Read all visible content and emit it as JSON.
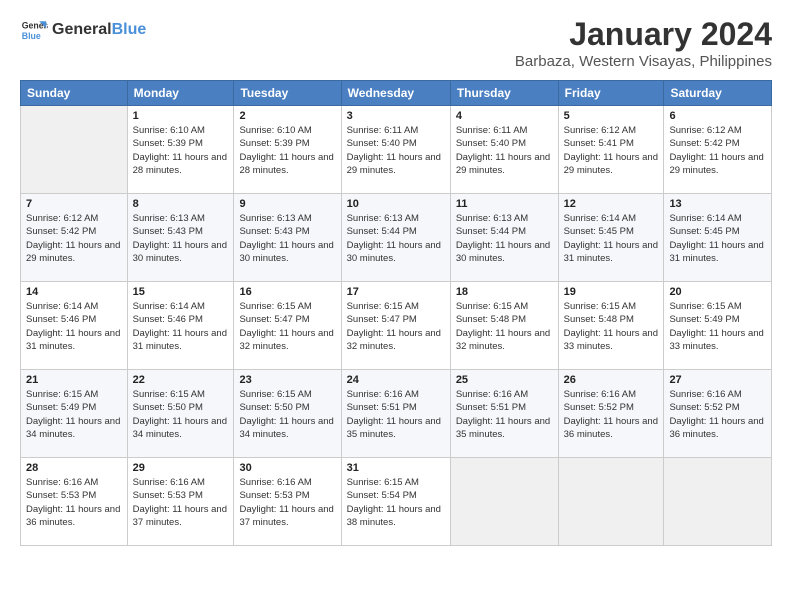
{
  "header": {
    "logo_general": "General",
    "logo_blue": "Blue",
    "title": "January 2024",
    "location": "Barbaza, Western Visayas, Philippines"
  },
  "days_of_week": [
    "Sunday",
    "Monday",
    "Tuesday",
    "Wednesday",
    "Thursday",
    "Friday",
    "Saturday"
  ],
  "weeks": [
    [
      {
        "day": "",
        "sunrise": "",
        "sunset": "",
        "daylight": ""
      },
      {
        "day": "1",
        "sunrise": "Sunrise: 6:10 AM",
        "sunset": "Sunset: 5:39 PM",
        "daylight": "Daylight: 11 hours and 28 minutes."
      },
      {
        "day": "2",
        "sunrise": "Sunrise: 6:10 AM",
        "sunset": "Sunset: 5:39 PM",
        "daylight": "Daylight: 11 hours and 28 minutes."
      },
      {
        "day": "3",
        "sunrise": "Sunrise: 6:11 AM",
        "sunset": "Sunset: 5:40 PM",
        "daylight": "Daylight: 11 hours and 29 minutes."
      },
      {
        "day": "4",
        "sunrise": "Sunrise: 6:11 AM",
        "sunset": "Sunset: 5:40 PM",
        "daylight": "Daylight: 11 hours and 29 minutes."
      },
      {
        "day": "5",
        "sunrise": "Sunrise: 6:12 AM",
        "sunset": "Sunset: 5:41 PM",
        "daylight": "Daylight: 11 hours and 29 minutes."
      },
      {
        "day": "6",
        "sunrise": "Sunrise: 6:12 AM",
        "sunset": "Sunset: 5:42 PM",
        "daylight": "Daylight: 11 hours and 29 minutes."
      }
    ],
    [
      {
        "day": "7",
        "sunrise": "Sunrise: 6:12 AM",
        "sunset": "Sunset: 5:42 PM",
        "daylight": "Daylight: 11 hours and 29 minutes."
      },
      {
        "day": "8",
        "sunrise": "Sunrise: 6:13 AM",
        "sunset": "Sunset: 5:43 PM",
        "daylight": "Daylight: 11 hours and 30 minutes."
      },
      {
        "day": "9",
        "sunrise": "Sunrise: 6:13 AM",
        "sunset": "Sunset: 5:43 PM",
        "daylight": "Daylight: 11 hours and 30 minutes."
      },
      {
        "day": "10",
        "sunrise": "Sunrise: 6:13 AM",
        "sunset": "Sunset: 5:44 PM",
        "daylight": "Daylight: 11 hours and 30 minutes."
      },
      {
        "day": "11",
        "sunrise": "Sunrise: 6:13 AM",
        "sunset": "Sunset: 5:44 PM",
        "daylight": "Daylight: 11 hours and 30 minutes."
      },
      {
        "day": "12",
        "sunrise": "Sunrise: 6:14 AM",
        "sunset": "Sunset: 5:45 PM",
        "daylight": "Daylight: 11 hours and 31 minutes."
      },
      {
        "day": "13",
        "sunrise": "Sunrise: 6:14 AM",
        "sunset": "Sunset: 5:45 PM",
        "daylight": "Daylight: 11 hours and 31 minutes."
      }
    ],
    [
      {
        "day": "14",
        "sunrise": "Sunrise: 6:14 AM",
        "sunset": "Sunset: 5:46 PM",
        "daylight": "Daylight: 11 hours and 31 minutes."
      },
      {
        "day": "15",
        "sunrise": "Sunrise: 6:14 AM",
        "sunset": "Sunset: 5:46 PM",
        "daylight": "Daylight: 11 hours and 31 minutes."
      },
      {
        "day": "16",
        "sunrise": "Sunrise: 6:15 AM",
        "sunset": "Sunset: 5:47 PM",
        "daylight": "Daylight: 11 hours and 32 minutes."
      },
      {
        "day": "17",
        "sunrise": "Sunrise: 6:15 AM",
        "sunset": "Sunset: 5:47 PM",
        "daylight": "Daylight: 11 hours and 32 minutes."
      },
      {
        "day": "18",
        "sunrise": "Sunrise: 6:15 AM",
        "sunset": "Sunset: 5:48 PM",
        "daylight": "Daylight: 11 hours and 32 minutes."
      },
      {
        "day": "19",
        "sunrise": "Sunrise: 6:15 AM",
        "sunset": "Sunset: 5:48 PM",
        "daylight": "Daylight: 11 hours and 33 minutes."
      },
      {
        "day": "20",
        "sunrise": "Sunrise: 6:15 AM",
        "sunset": "Sunset: 5:49 PM",
        "daylight": "Daylight: 11 hours and 33 minutes."
      }
    ],
    [
      {
        "day": "21",
        "sunrise": "Sunrise: 6:15 AM",
        "sunset": "Sunset: 5:49 PM",
        "daylight": "Daylight: 11 hours and 34 minutes."
      },
      {
        "day": "22",
        "sunrise": "Sunrise: 6:15 AM",
        "sunset": "Sunset: 5:50 PM",
        "daylight": "Daylight: 11 hours and 34 minutes."
      },
      {
        "day": "23",
        "sunrise": "Sunrise: 6:15 AM",
        "sunset": "Sunset: 5:50 PM",
        "daylight": "Daylight: 11 hours and 34 minutes."
      },
      {
        "day": "24",
        "sunrise": "Sunrise: 6:16 AM",
        "sunset": "Sunset: 5:51 PM",
        "daylight": "Daylight: 11 hours and 35 minutes."
      },
      {
        "day": "25",
        "sunrise": "Sunrise: 6:16 AM",
        "sunset": "Sunset: 5:51 PM",
        "daylight": "Daylight: 11 hours and 35 minutes."
      },
      {
        "day": "26",
        "sunrise": "Sunrise: 6:16 AM",
        "sunset": "Sunset: 5:52 PM",
        "daylight": "Daylight: 11 hours and 36 minutes."
      },
      {
        "day": "27",
        "sunrise": "Sunrise: 6:16 AM",
        "sunset": "Sunset: 5:52 PM",
        "daylight": "Daylight: 11 hours and 36 minutes."
      }
    ],
    [
      {
        "day": "28",
        "sunrise": "Sunrise: 6:16 AM",
        "sunset": "Sunset: 5:53 PM",
        "daylight": "Daylight: 11 hours and 36 minutes."
      },
      {
        "day": "29",
        "sunrise": "Sunrise: 6:16 AM",
        "sunset": "Sunset: 5:53 PM",
        "daylight": "Daylight: 11 hours and 37 minutes."
      },
      {
        "day": "30",
        "sunrise": "Sunrise: 6:16 AM",
        "sunset": "Sunset: 5:53 PM",
        "daylight": "Daylight: 11 hours and 37 minutes."
      },
      {
        "day": "31",
        "sunrise": "Sunrise: 6:15 AM",
        "sunset": "Sunset: 5:54 PM",
        "daylight": "Daylight: 11 hours and 38 minutes."
      },
      {
        "day": "",
        "sunrise": "",
        "sunset": "",
        "daylight": ""
      },
      {
        "day": "",
        "sunrise": "",
        "sunset": "",
        "daylight": ""
      },
      {
        "day": "",
        "sunrise": "",
        "sunset": "",
        "daylight": ""
      }
    ]
  ]
}
